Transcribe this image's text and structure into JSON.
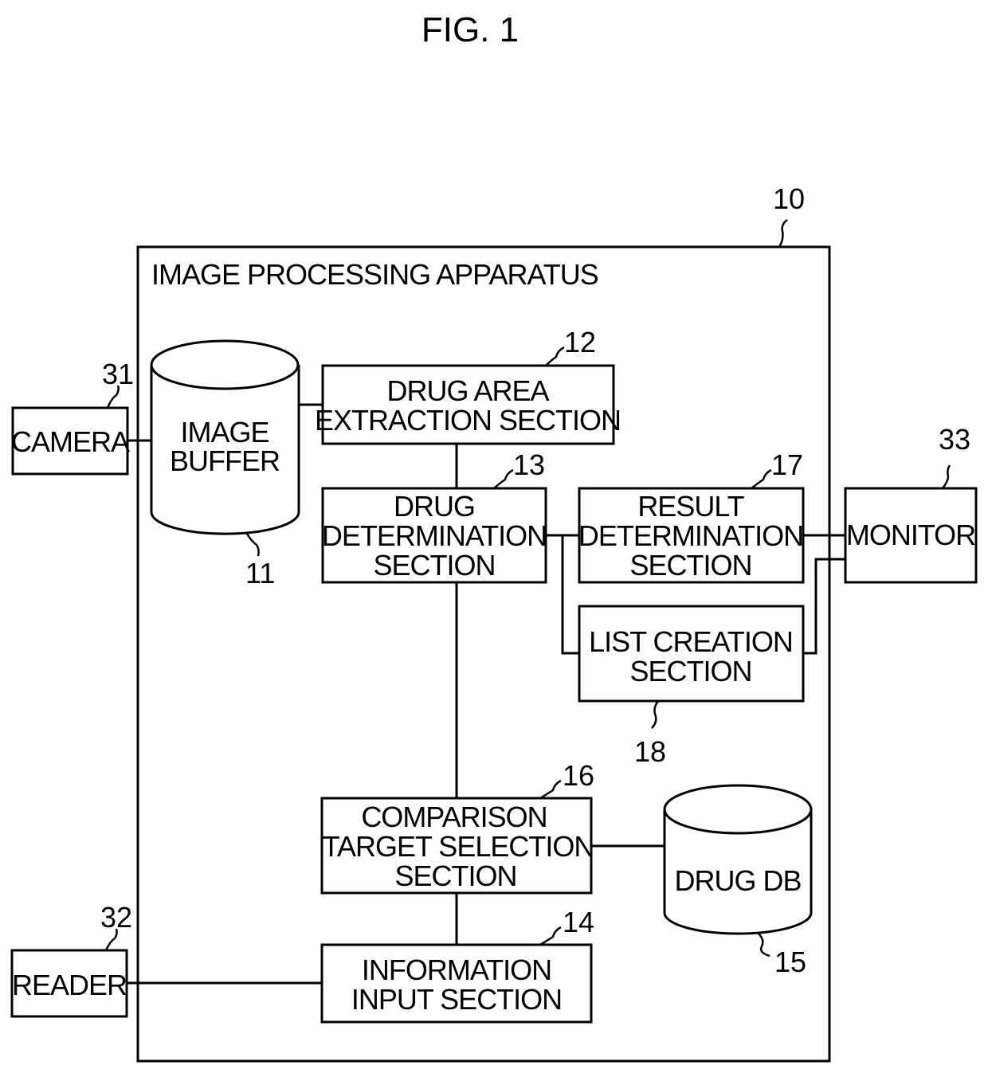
{
  "figure_title": "FIG. 1",
  "apparatus": {
    "label": "IMAGE PROCESSING APPARATUS",
    "ref": "10"
  },
  "blocks": {
    "camera": {
      "lines": [
        "CAMERA"
      ],
      "ref": "31"
    },
    "reader": {
      "lines": [
        "READER"
      ],
      "ref": "32"
    },
    "monitor": {
      "lines": [
        "MONITOR"
      ],
      "ref": "33"
    },
    "image_buffer": {
      "lines": [
        "IMAGE",
        "BUFFER"
      ],
      "ref": "11"
    },
    "drug_area_extraction": {
      "lines": [
        "DRUG AREA",
        "EXTRACTION SECTION"
      ],
      "ref": "12"
    },
    "drug_determination": {
      "lines": [
        "DRUG",
        "DETERMINATION",
        "SECTION"
      ],
      "ref": "13"
    },
    "result_determination": {
      "lines": [
        "RESULT",
        "DETERMINATION",
        "SECTION"
      ],
      "ref": "17"
    },
    "list_creation": {
      "lines": [
        "LIST CREATION",
        "SECTION"
      ],
      "ref": "18"
    },
    "comparison_target_selection": {
      "lines": [
        "COMPARISON",
        "TARGET SELECTION",
        "SECTION"
      ],
      "ref": "16"
    },
    "drug_db": {
      "lines": [
        "DRUG DB"
      ],
      "ref": "15"
    },
    "information_input": {
      "lines": [
        "INFORMATION",
        "INPUT SECTION"
      ],
      "ref": "14"
    }
  }
}
